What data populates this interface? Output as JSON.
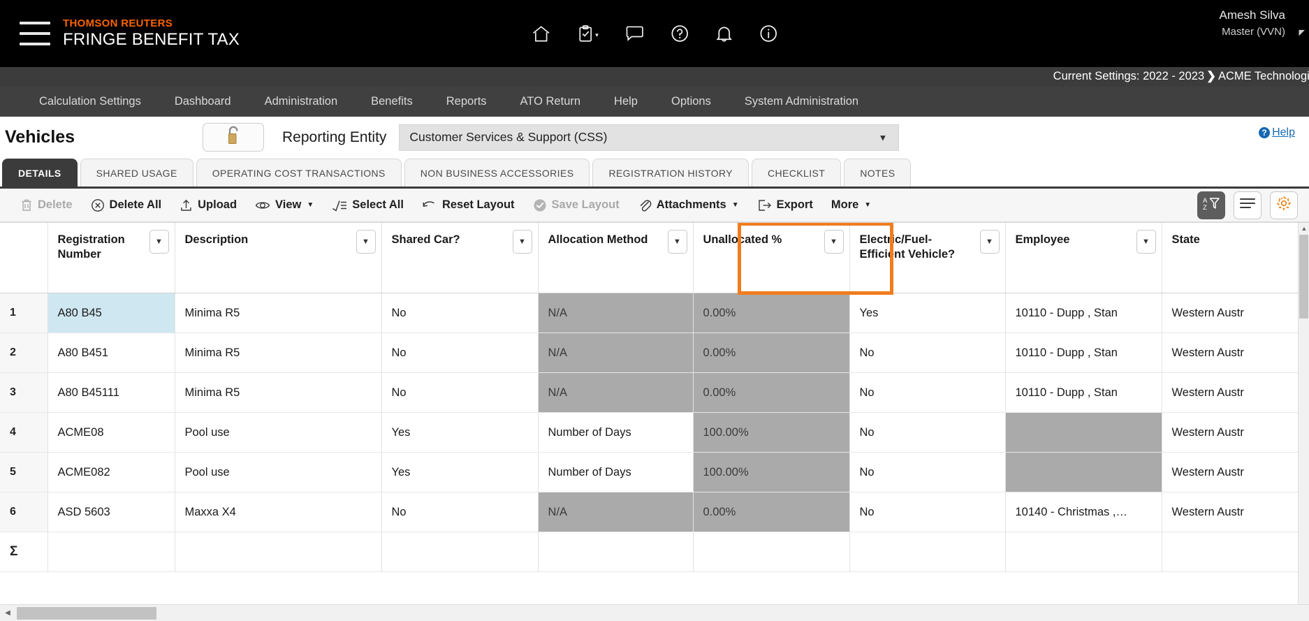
{
  "header": {
    "brand_top": "THOMSON REUTERS",
    "brand_main": "FRINGE BENEFIT TAX",
    "menu_icon": "hamburger-icon",
    "icons": [
      {
        "name": "home-icon",
        "label": "Home"
      },
      {
        "name": "tasks-icon",
        "label": "Tasks"
      },
      {
        "name": "chat-icon",
        "label": "Chat"
      },
      {
        "name": "question-icon",
        "label": "Help"
      },
      {
        "name": "bell-icon",
        "label": "Notifications"
      },
      {
        "name": "info-icon",
        "label": "Information"
      }
    ],
    "user_name": "Amesh Silva",
    "user_role": "Master (VVN)"
  },
  "settings_bar": {
    "prefix": "Current Settings: 2022 - 2023",
    "separator": "❯",
    "entity": "ACME Technologie"
  },
  "nav": {
    "items": [
      {
        "label": "Calculation Settings"
      },
      {
        "label": "Dashboard"
      },
      {
        "label": "Administration"
      },
      {
        "label": "Benefits"
      },
      {
        "label": "Reports"
      },
      {
        "label": "ATO Return"
      },
      {
        "label": "Help"
      },
      {
        "label": "Options"
      },
      {
        "label": "System Administration"
      }
    ]
  },
  "page": {
    "title": "Vehicles",
    "lock_icon": "unlocked-padlock-icon",
    "reporting_entity_label": "Reporting Entity",
    "reporting_entity_value": "Customer Services & Support (CSS)",
    "help_label": "Help"
  },
  "tabs": [
    {
      "label": "DETAILS",
      "active": true
    },
    {
      "label": "SHARED USAGE",
      "active": false
    },
    {
      "label": "OPERATING COST TRANSACTIONS",
      "active": false
    },
    {
      "label": "NON BUSINESS ACCESSORIES",
      "active": false
    },
    {
      "label": "REGISTRATION HISTORY",
      "active": false
    },
    {
      "label": "CHECKLIST",
      "active": false
    },
    {
      "label": "NOTES",
      "active": false
    }
  ],
  "toolbar": {
    "buttons": [
      {
        "label": "Delete",
        "icon": "trash-icon",
        "disabled": true,
        "caret": false
      },
      {
        "label": "Delete All",
        "icon": "circle-x-icon",
        "disabled": false,
        "caret": false
      },
      {
        "label": "Upload",
        "icon": "upload-icon",
        "disabled": false,
        "caret": false
      },
      {
        "label": "View",
        "icon": "eye-icon",
        "disabled": false,
        "caret": true
      },
      {
        "label": "Select All",
        "icon": "select-all-icon",
        "disabled": false,
        "caret": false
      },
      {
        "label": "Reset Layout",
        "icon": "undo-icon",
        "disabled": false,
        "caret": false
      },
      {
        "label": "Save Layout",
        "icon": "check-circle-icon",
        "disabled": true,
        "caret": false
      },
      {
        "label": "Attachments",
        "icon": "paperclip-icon",
        "disabled": false,
        "caret": true
      },
      {
        "label": "Export",
        "icon": "export-icon",
        "disabled": false,
        "caret": false
      },
      {
        "label": "More",
        "icon": "",
        "disabled": false,
        "caret": true
      }
    ],
    "right_buttons": [
      {
        "name": "sort-filter-button",
        "icon": "az-filter-icon",
        "active": true
      },
      {
        "name": "list-view-button",
        "icon": "list-lines-icon",
        "active": false
      },
      {
        "name": "settings-button",
        "icon": "gear-icon",
        "active": false
      }
    ]
  },
  "grid": {
    "columns": [
      {
        "key": "rownum",
        "label": "",
        "dropdown": false,
        "align": "center"
      },
      {
        "key": "registration_number",
        "label": "Registration Number",
        "dropdown": true,
        "align": "left"
      },
      {
        "key": "description",
        "label": "Description",
        "dropdown": true,
        "align": "left"
      },
      {
        "key": "shared_car",
        "label": "Shared Car?",
        "dropdown": true,
        "align": "left"
      },
      {
        "key": "allocation_method",
        "label": "Allocation Method",
        "dropdown": true,
        "align": "left"
      },
      {
        "key": "unallocated_pct",
        "label": "Unallocated %",
        "dropdown": true,
        "align": "right"
      },
      {
        "key": "electric_fuel_efficient",
        "label": "Electric/Fuel-Efficient Vehicle?",
        "dropdown": true,
        "align": "left"
      },
      {
        "key": "employee",
        "label": "Employee",
        "dropdown": true,
        "align": "left"
      },
      {
        "key": "state",
        "label": "State",
        "dropdown": false,
        "align": "left"
      }
    ],
    "highlighted_column": "electric_fuel_efficient",
    "highlight_color": "#f07c1e",
    "rows": [
      {
        "rownum": "1",
        "registration_number": "A80 B45",
        "description": "Minima R5",
        "shared_car": "No",
        "allocation_method": "N/A",
        "unallocated_pct": "0.00%",
        "electric_fuel_efficient": "Yes",
        "employee": "10110 - Dupp , Stan",
        "state": "Western Austr",
        "selected_cell": "registration_number",
        "greyed": [
          "allocation_method",
          "unallocated_pct"
        ]
      },
      {
        "rownum": "2",
        "registration_number": "A80 B451",
        "description": "Minima R5",
        "shared_car": "No",
        "allocation_method": "N/A",
        "unallocated_pct": "0.00%",
        "electric_fuel_efficient": "No",
        "employee": "10110 - Dupp , Stan",
        "state": "Western Austr",
        "selected_cell": "",
        "greyed": [
          "allocation_method",
          "unallocated_pct"
        ]
      },
      {
        "rownum": "3",
        "registration_number": "A80 B45111",
        "description": "Minima R5",
        "shared_car": "No",
        "allocation_method": "N/A",
        "unallocated_pct": "0.00%",
        "electric_fuel_efficient": "No",
        "employee": "10110 - Dupp , Stan",
        "state": "Western Austr",
        "selected_cell": "",
        "greyed": [
          "allocation_method",
          "unallocated_pct"
        ]
      },
      {
        "rownum": "4",
        "registration_number": "ACME08",
        "description": "Pool use",
        "shared_car": "Yes",
        "allocation_method": "Number of Days",
        "unallocated_pct": "100.00%",
        "electric_fuel_efficient": "No",
        "employee": "",
        "state": "Western Austr",
        "selected_cell": "",
        "greyed": [
          "unallocated_pct",
          "employee"
        ]
      },
      {
        "rownum": "5",
        "registration_number": "ACME082",
        "description": "Pool use",
        "shared_car": "Yes",
        "allocation_method": "Number of Days",
        "unallocated_pct": "100.00%",
        "electric_fuel_efficient": "No",
        "employee": "",
        "state": "Western Austr",
        "selected_cell": "",
        "greyed": [
          "unallocated_pct",
          "employee"
        ]
      },
      {
        "rownum": "6",
        "registration_number": "ASD 5603",
        "description": "Maxxa X4",
        "shared_car": "No",
        "allocation_method": "N/A",
        "unallocated_pct": "0.00%",
        "electric_fuel_efficient": "No",
        "employee": "10140 - Christmas ,…",
        "state": "Western Austr",
        "selected_cell": "",
        "greyed": [
          "allocation_method",
          "unallocated_pct"
        ]
      }
    ],
    "summary_row": {
      "rownum": "Σ",
      "registration_number": "",
      "description": "",
      "shared_car": "",
      "allocation_method": "",
      "unallocated_pct": "",
      "electric_fuel_efficient": "",
      "employee": "",
      "state": ""
    }
  }
}
